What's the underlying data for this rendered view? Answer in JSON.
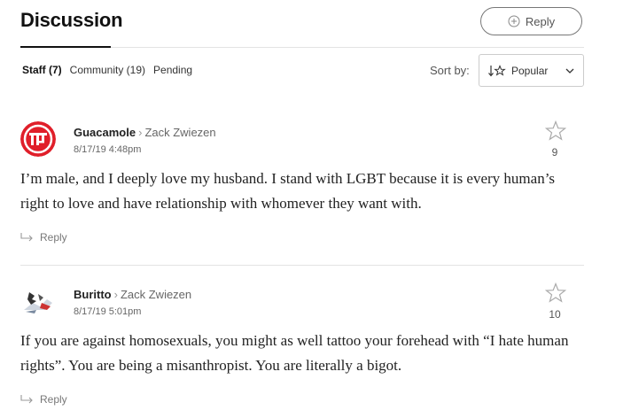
{
  "header": {
    "title": "Discussion",
    "reply_label": "Reply"
  },
  "filters": {
    "tabs": [
      "Staff (7)",
      "Community (19)",
      "Pending"
    ],
    "active_tab": "Staff (7)"
  },
  "sort": {
    "label": "Sort by:",
    "value": "Popular"
  },
  "comments": [
    {
      "author": "Guacamole",
      "reply_to": "Zack Zwiezen",
      "date": "8/17/19 4:48pm",
      "star_count": "9",
      "text": "I’m male, and I deeply love my husband. I stand with LGBT because it is every human’s right to love and have relationship with whomever they want with.",
      "reply_label": "Reply"
    },
    {
      "author": "Buritto",
      "reply_to": "Zack Zwiezen",
      "date": "8/17/19 5:01pm",
      "star_count": "10",
      "text": "If you are against homosexuals, you might as well tattoo your forehead with “I hate human rights”. You are being a misanthropist. You are literally a bigot.",
      "reply_label": "Reply"
    }
  ],
  "colors": {
    "avatar1_red": "#e01f2a",
    "text": "#222222",
    "muted": "#777777"
  }
}
